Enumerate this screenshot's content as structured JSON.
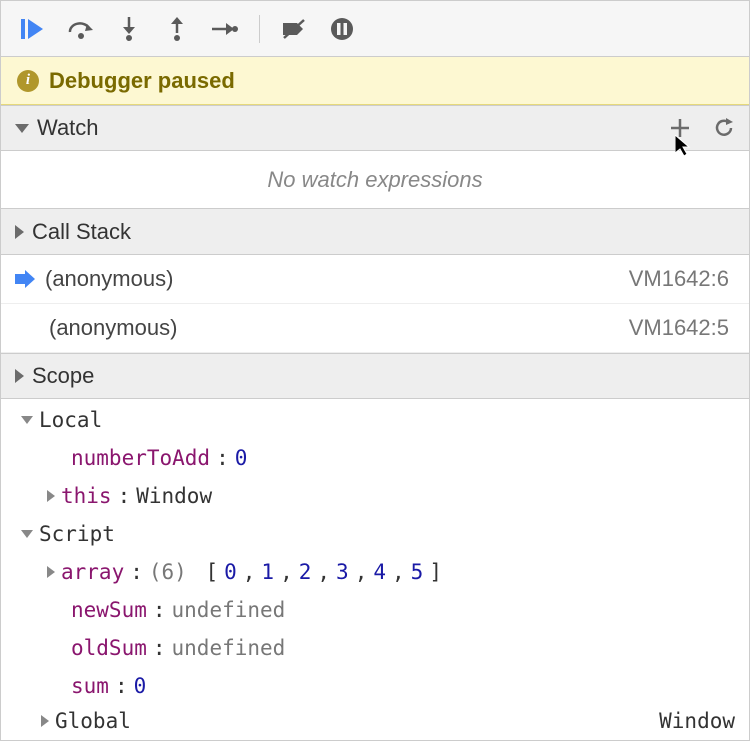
{
  "status": {
    "label": "Debugger paused"
  },
  "watch": {
    "title": "Watch",
    "empty_message": "No watch expressions"
  },
  "callstack": {
    "title": "Call Stack",
    "frames": [
      {
        "name": "(anonymous)",
        "location": "VM1642:6",
        "current": true
      },
      {
        "name": "(anonymous)",
        "location": "VM1642:5",
        "current": false
      }
    ]
  },
  "scope": {
    "title": "Scope",
    "local": {
      "label": "Local",
      "vars": {
        "numberToAdd": {
          "value": "0",
          "type": "num"
        },
        "this": {
          "value": "Window",
          "type": "plain",
          "expandable": true
        }
      }
    },
    "script": {
      "label": "Script",
      "vars": {
        "array": {
          "prefix": "(6)",
          "items": [
            "0",
            "1",
            "2",
            "3",
            "4",
            "5"
          ],
          "expandable": true
        },
        "newSum": {
          "value": "undefined",
          "type": "gray"
        },
        "oldSum": {
          "value": "undefined",
          "type": "gray"
        },
        "sum": {
          "value": "0",
          "type": "num"
        }
      }
    },
    "global": {
      "label": "Global",
      "value": "Window"
    }
  }
}
